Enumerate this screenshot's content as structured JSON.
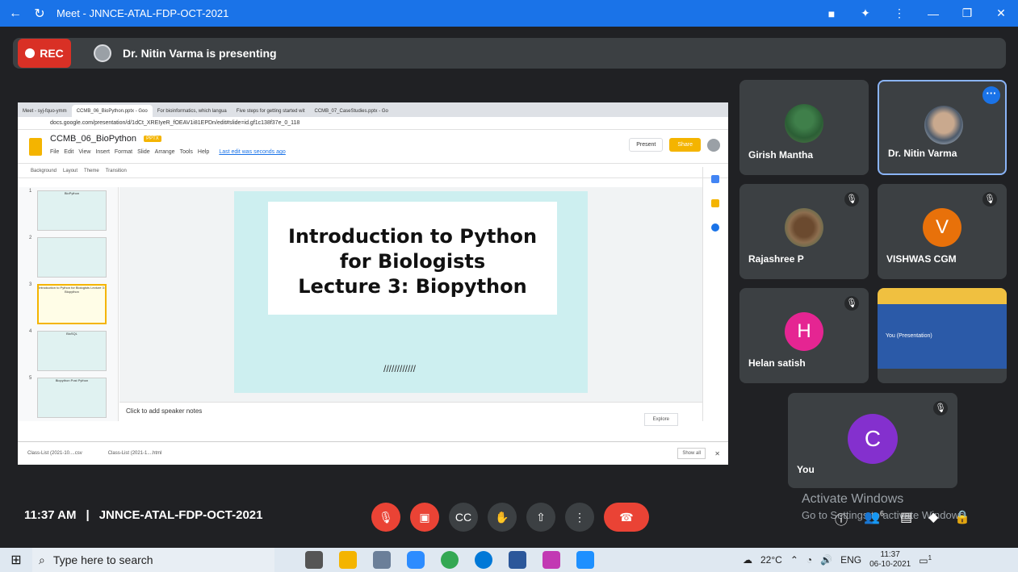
{
  "window": {
    "title": "Meet - JNNCE-ATAL-FDP-OCT-2021",
    "back_icon": "←",
    "reload_icon": "↻"
  },
  "topbar": {
    "rec_label": "REC",
    "presenting_text": "Dr. Nitin Varma is presenting"
  },
  "shared_screen": {
    "tabs": [
      "Meet - syj-fquo-ymm",
      "CCMB_06_BioPython.pptx - Goo",
      "For bioinformatics, which langua",
      "Five steps for getting started wit",
      "CCMB_07_CaseStudies.pptx - Go"
    ],
    "url": "docs.google.com/presentation/d/1dCt_XREIyeR_fOEAV1i81EPDn/edit#slide=id.gf1c138f37e_0_118",
    "doc_title": "CCMB_06_BioPython",
    "doc_badge": "PPTX",
    "menu": [
      "File",
      "Edit",
      "View",
      "Insert",
      "Format",
      "Slide",
      "Arrange",
      "Tools",
      "Help"
    ],
    "last_edit": "Last edit was seconds ago",
    "present_label": "Present",
    "share_label": "Share",
    "toolbar_items": [
      "Background",
      "Layout",
      "Theme",
      "Transition"
    ],
    "thumb_numbers": [
      "1",
      "2",
      "3",
      "4",
      "5"
    ],
    "thumb_labels": [
      "BioPython",
      "",
      "Introduction to Python for Biologists Lecture 3: Biopython",
      "BioSQL",
      "Biopython Post Python"
    ],
    "slide_title_lines": [
      "Introduction to Python",
      "for Biologists",
      "Lecture 3: Biopython"
    ],
    "slide_deco": "////////////",
    "notes_placeholder": "Click to add speaker notes",
    "explore_label": "Explore",
    "downloads": [
      "Class-List (2021-10....csv",
      "Class-List (2021-1....html"
    ],
    "show_all": "Show all"
  },
  "participants": [
    {
      "name": "Girish Mantha",
      "muted": false
    },
    {
      "name": "Dr. Nitin Varma",
      "muted": false,
      "pinned": true
    },
    {
      "name": "Rajashree P",
      "muted": true
    },
    {
      "name": "VISHWAS CGM",
      "initial": "V",
      "color": "#e8710a",
      "muted": true
    },
    {
      "name": "Helan satish",
      "initial": "H",
      "color": "#e52592",
      "muted": true
    },
    {
      "name": "You",
      "initial": "C",
      "color": "#8430ce",
      "muted": true
    }
  ],
  "presentation_tile": {
    "caption": "You (Presentation)"
  },
  "bottom": {
    "time": "11:37 AM",
    "separator": "|",
    "meeting_code": "JNNCE-ATAL-FDP-OCT-2021",
    "participant_count": "6",
    "watermark_title": "Activate Windows",
    "watermark_sub": "Go to Settings to activate Windows."
  },
  "taskbar": {
    "search_placeholder": "Type here to search",
    "temperature": "22°C",
    "language": "ENG",
    "time": "11:37",
    "date": "06-10-2021",
    "notification_count": "1"
  }
}
